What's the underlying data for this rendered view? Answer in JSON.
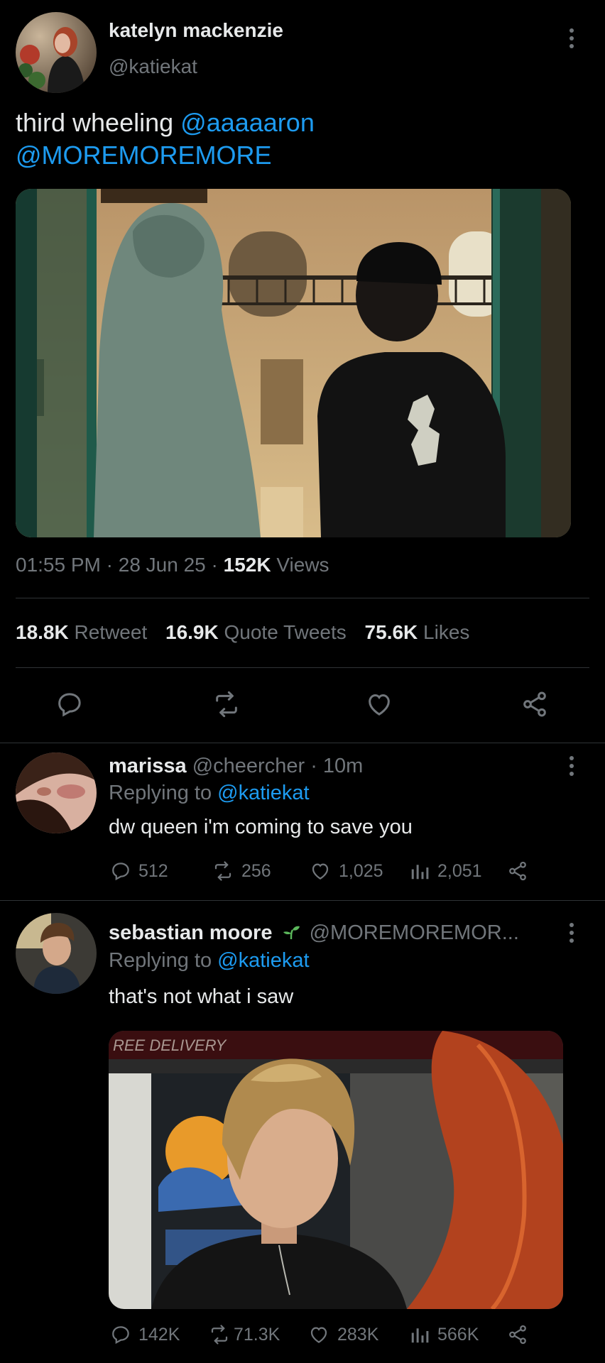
{
  "tweet": {
    "author_name": "katelyn mackenzie",
    "author_handle": "@katiekat",
    "text_plain": "third wheeling",
    "mention_1": "@aaaaaron",
    "mention_2": "@MOREMOREMORE",
    "time": "01:55 PM",
    "date": "28 Jun 25",
    "views_count": "152K",
    "views_label": "Views",
    "dot": "·",
    "retweets_count": "18.8K",
    "retweets_label": "Retweet",
    "quotes_count": "16.9K",
    "quotes_label": "Quote Tweets",
    "likes_count": "75.6K",
    "likes_label": "Likes"
  },
  "replies": [
    {
      "name": "marissa",
      "handle": "@cheercher",
      "dot": "·",
      "time": "10m",
      "replying_label": "Replying to",
      "replying_to": "@katiekat",
      "text": "dw queen i'm coming to save you",
      "reply_count": "512",
      "retweet_count": "256",
      "like_count": "1,025",
      "view_count": "2,051"
    },
    {
      "name": "sebastian moore",
      "badge_icon": "seedling-icon",
      "handle": "@MOREMOREMOR...",
      "replying_label": "Replying to",
      "replying_to": "@katiekat",
      "text": "that's not what i saw",
      "image_sign_text": "REE DELIVERY",
      "reply_count": "142K",
      "retweet_count": "71.3K",
      "like_count": "283K",
      "view_count": "566K"
    }
  ],
  "colors": {
    "background": "#000000",
    "text": "#e7e9ea",
    "secondary": "#71767b",
    "link": "#1d9bf0",
    "separator": "#2f3336"
  }
}
